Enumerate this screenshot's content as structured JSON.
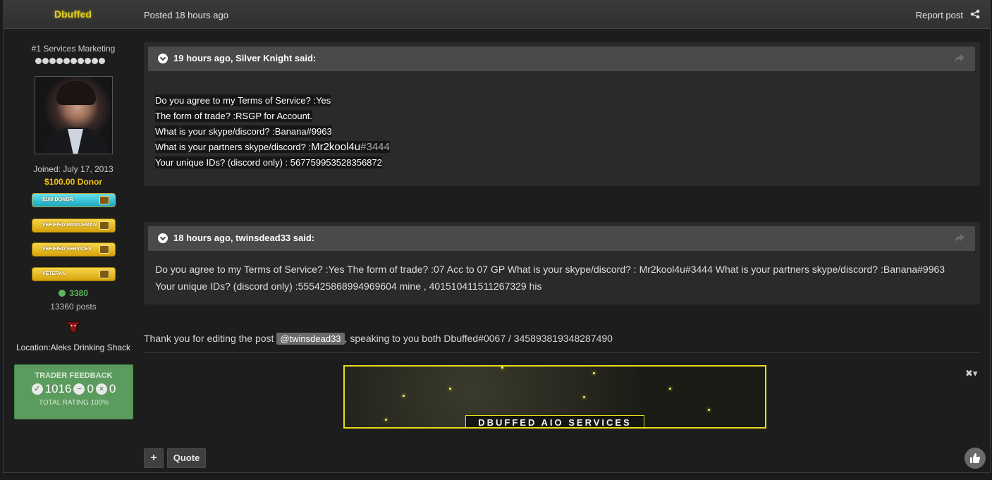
{
  "header": {
    "author": "Dbuffed",
    "posted": "Posted 18 hours ago",
    "report": "Report post",
    "share_icon": "share-icon"
  },
  "profile": {
    "rank": "#1 Services Marketing",
    "pips": 10,
    "joined": "Joined: July 17, 2013",
    "donor": "$100.00 Donor",
    "awards": [
      "$100 DONOR",
      "VERIFIED MIDDLEMAN",
      "VERIFIED SERVICES",
      "VETERAN"
    ],
    "reputation": "3380",
    "posts": "13360 posts",
    "location": "Location:Aleks Drinking Shack",
    "feedback": {
      "title": "TRADER FEEDBACK",
      "positive": "1016",
      "neutral": "0",
      "negative": "0",
      "total": "TOTAL RATING 100%"
    }
  },
  "quotes": [
    {
      "cite": "19 hours ago, Silver Knight said:",
      "lines": [
        "Do you agree to my Terms of Service? :Yes",
        "The form of trade? :RSGP for Account.",
        "What is your skype/discord? :Banana#9963",
        "What is your partners skype/discord? :",
        "Your unique IDs? (discord only) : 567759953528356872"
      ],
      "partner_name": "Mr2kool4u",
      "partner_tag": "#3444"
    },
    {
      "cite": "18 hours ago, twinsdead33 said:",
      "body": "Do you agree to my Terms of Service? :Yes The form of trade? :07 Acc to 07 GP What is your skype/discord? : Mr2kool4u#3444 What is your partners skype/discord? :Banana#9963 Your unique IDs? (discord only) :555425868994969604 mine , 401510411511267329 his"
    }
  ],
  "reply": {
    "before": "Thank you for editing the post ",
    "mention": "@twinsdead33",
    "after": ", speaking to you both Dbuffed#0067 / 345893819348287490"
  },
  "signature": {
    "banner_text": "DBUFFED AIO SERVICES",
    "menu": "✖▾"
  },
  "actions": {
    "plus": "+",
    "quote": "Quote",
    "like_icon": "thumbs-up-icon"
  }
}
